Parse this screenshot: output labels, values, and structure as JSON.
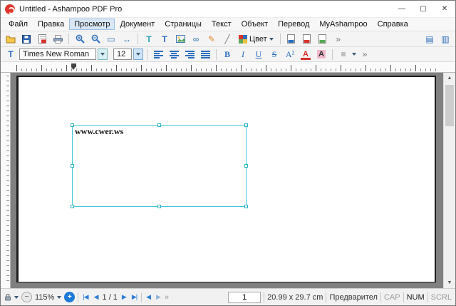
{
  "window": {
    "title": "Untitled - Ashampoo PDF Pro"
  },
  "titlebar": {
    "minimize_label": "—",
    "maximize_label": "▢",
    "close_label": "✕"
  },
  "menubar": {
    "items": [
      {
        "label": "Файл"
      },
      {
        "label": "Правка"
      },
      {
        "label": "Просмотр",
        "active": true
      },
      {
        "label": "Документ"
      },
      {
        "label": "Страницы"
      },
      {
        "label": "Текст"
      },
      {
        "label": "Объект"
      },
      {
        "label": "Перевод"
      },
      {
        "label": "MyAshampoo"
      },
      {
        "label": "Справка"
      }
    ]
  },
  "toolbar_main": {
    "glyphs": {
      "fit_page": "▭",
      "fit_width": "↔",
      "add_text": "T",
      "edit_text": "T",
      "link": "∞",
      "draw": "✎",
      "eyedropper": "╱",
      "panel_left": "▤",
      "panel_right": "▥"
    },
    "color_label": "Цвет",
    "overflow_label": "»",
    "icon_names": [
      "open-icon",
      "save-icon",
      "export-pdf-icon",
      "print-icon",
      "zoom-in-icon",
      "zoom-out-icon",
      "fit-page-icon",
      "fit-width-icon",
      "add-text-icon",
      "edit-text-icon",
      "insert-image-icon",
      "insert-link-icon",
      "draw-icon",
      "eyedropper-icon",
      "color-swatch-icon",
      "export-doc-blue-icon",
      "export-doc-red-icon",
      "export-doc-green-icon"
    ]
  },
  "toolbar_text": {
    "tool_glyph": "T",
    "font_name": "Times New Roman",
    "font_size": "12",
    "bold_label": "B",
    "italic_label": "I",
    "underline_label": "U",
    "strike_label": "S",
    "superscript_label": "A²",
    "font_color_label": "A",
    "highlight_label": "A",
    "line_spacing_glyph": "≡",
    "overflow_label": "»"
  },
  "document": {
    "textbox_text": "www.cwer.ws"
  },
  "scrollbar": {
    "up_glyph": "▲",
    "down_glyph": "▼"
  },
  "statusbar": {
    "zoom_out_glyph": "−",
    "zoom_level": "115%",
    "zoom_in_glyph": "+",
    "nav_first_glyph": "|◀",
    "nav_prev_glyph": "◀",
    "page_position": "1 / 1",
    "nav_next_glyph": "▶",
    "nav_last_glyph": "▶|",
    "back_glyph": "◀",
    "forward_glyph": "▶",
    "overflow_label": "»",
    "page_field_value": "1",
    "page_size": "20.99 x 29.7 cm",
    "preview_label": "Предварител",
    "caps_label": "CAP",
    "num_label": "NUM",
    "scroll_label": "SCRL"
  },
  "colors": {
    "accent_blue": "#2e6fbd",
    "icon_teal": "#2aa6b5",
    "selection_cyan": "#45c6d8",
    "logo_red": "#e0372e",
    "draw_orange": "#e08a2e",
    "font_color_red": "#d8322c",
    "highlight_pink": "#f2b8cc"
  }
}
